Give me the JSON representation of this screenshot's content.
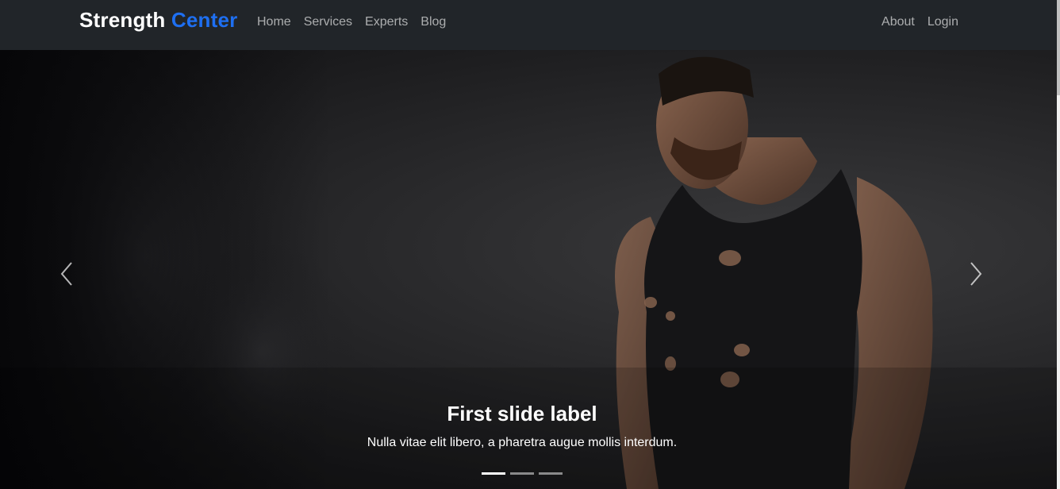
{
  "navbar": {
    "brand_part1": "Strength",
    "brand_part2": "Center",
    "left_links": [
      "Home",
      "Services",
      "Experts",
      "Blog"
    ],
    "right_links": [
      "About",
      "Login"
    ]
  },
  "carousel": {
    "active_slide": 1,
    "slide_count": 3,
    "caption_title": "First slide label",
    "caption_text": "Nulla vitae elit libero, a pharetra augue mollis interdum.",
    "prev_icon": "chevron-left-icon",
    "next_icon": "chevron-right-icon"
  },
  "colors": {
    "navbar_bg": "#212529",
    "brand_accent": "#1e6ff1",
    "nav_link": "rgba(255,255,255,0.62)"
  }
}
